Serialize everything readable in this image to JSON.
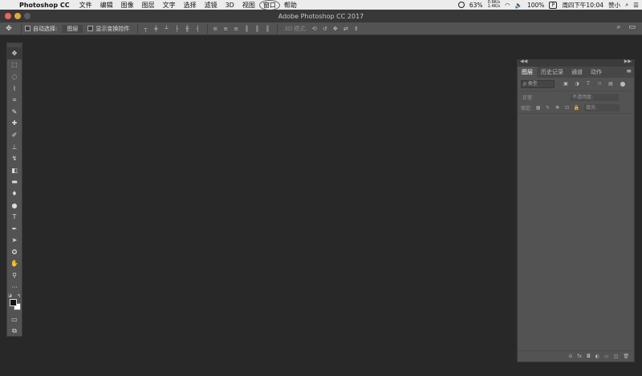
{
  "menubar": {
    "apple_glyph": "",
    "app_name": "Photoshop CC",
    "items": [
      "文件",
      "编辑",
      "图像",
      "图层",
      "文字",
      "选择",
      "滤镜",
      "3D",
      "视图",
      "窗口",
      "帮助"
    ],
    "active_item": "窗口",
    "battery_percent": "63%",
    "net_up": "0.9K/s",
    "net_down": "1.4K/s",
    "volume_glyph": "🔈",
    "battery_text": "100%",
    "input_flag": "P",
    "clock": "周四下午10:04",
    "user": "赞小",
    "search_glyph": "⌕",
    "menu_glyph": "☰"
  },
  "window": {
    "title": "Adobe Photoshop CC 2017"
  },
  "options_bar": {
    "move_tool_glyph": "✥",
    "auto_select_label": "自动选择:",
    "auto_select_value": "图层",
    "show_transform_label": "显示变换控件",
    "align_glyphs": [
      "┬",
      "╪",
      "┴",
      "├",
      "╫",
      "┤",
      "≡",
      "≡",
      "≡",
      "║",
      "║",
      "║"
    ],
    "mode3d_label": "3D 模式:",
    "mode3d_glyphs": [
      "⟲",
      "↺",
      "✥",
      "⇄",
      "⇕"
    ],
    "search_glyph": "⌕",
    "workspace_glyph": "▭"
  },
  "tools": [
    {
      "name": "move-tool",
      "glyph": "✥"
    },
    {
      "name": "marquee-tool",
      "glyph": "⬚"
    },
    {
      "name": "lasso-tool",
      "glyph": "◌"
    },
    {
      "name": "quick-select-tool",
      "glyph": "⌇"
    },
    {
      "name": "crop-tool",
      "glyph": "⌗"
    },
    {
      "name": "eyedropper-tool",
      "glyph": "✎"
    },
    {
      "name": "healing-brush-tool",
      "glyph": "✚"
    },
    {
      "name": "brush-tool",
      "glyph": "✐"
    },
    {
      "name": "clone-stamp-tool",
      "glyph": "⊥"
    },
    {
      "name": "history-brush-tool",
      "glyph": "↯"
    },
    {
      "name": "eraser-tool",
      "glyph": "◧"
    },
    {
      "name": "gradient-tool",
      "glyph": "▬"
    },
    {
      "name": "blur-tool",
      "glyph": "♦"
    },
    {
      "name": "dodge-tool",
      "glyph": "●"
    },
    {
      "name": "type-tool",
      "glyph": "T"
    },
    {
      "name": "pen-tool",
      "glyph": "✒"
    },
    {
      "name": "path-select-tool",
      "glyph": "➤"
    },
    {
      "name": "shape-tool",
      "glyph": "✪"
    },
    {
      "name": "hand-tool",
      "glyph": "✋"
    },
    {
      "name": "zoom-tool",
      "glyph": "⚲"
    },
    {
      "name": "more-tools",
      "glyph": "···"
    }
  ],
  "tools_bottom": [
    {
      "name": "quick-mask-tool",
      "glyph": "▭"
    },
    {
      "name": "screen-mode-tool",
      "glyph": "⧉"
    }
  ],
  "swatches": {
    "foreground": "#111111",
    "background": "#ffffff",
    "swap_glyph": "↰",
    "default_glyph": "◪"
  },
  "panel": {
    "collapse_left": "◀◀",
    "collapse_right": "▶▶",
    "tabs": [
      "图层",
      "历史记录",
      "通道",
      "动作"
    ],
    "active_tab": "图层",
    "menu_glyph": "≡",
    "kind_placeholder": "ρ 类型",
    "filter_glyphs": [
      "▣",
      "◑",
      "T",
      "⌑",
      "▤"
    ],
    "blend_mode": "正常",
    "opacity_label": "不透明度:",
    "lock_label": "锁定:",
    "lock_glyphs": [
      "▦",
      "✎",
      "✥",
      "⊡",
      "🔒"
    ],
    "fill_label": "填充:",
    "footer_glyphs": [
      "⊝",
      "fx",
      "◘",
      "◐",
      "▭",
      "◫",
      "🗑"
    ]
  },
  "colors": {
    "canvas": "#282828",
    "panel": "#535353",
    "menubar": "#ececec"
  }
}
